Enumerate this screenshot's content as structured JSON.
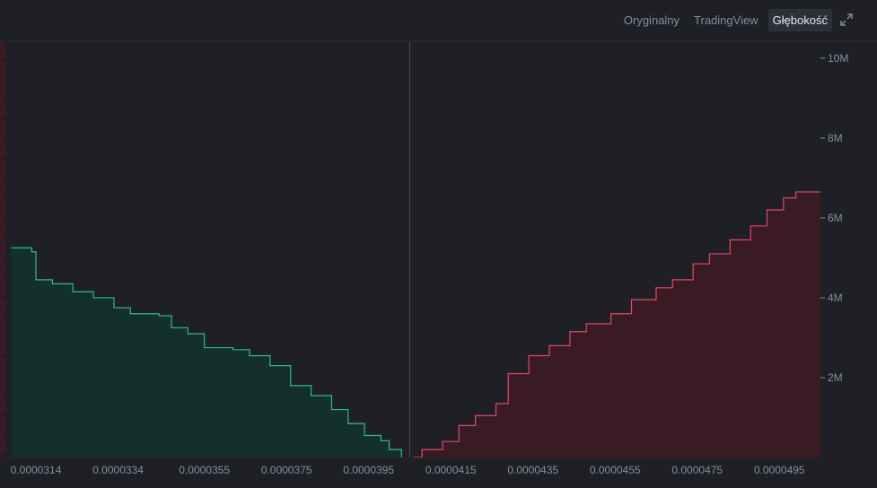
{
  "header": {
    "tabs": [
      {
        "label": "Oryginalny",
        "active": false
      },
      {
        "label": "TradingView",
        "active": false
      },
      {
        "label": "Głębokość",
        "active": true
      }
    ],
    "expand_icon": "expand-icon"
  },
  "colors": {
    "background": "#1e2026",
    "bid_line": "#2ebd85",
    "bid_fill": "#14302a",
    "ask_line": "#e0476b",
    "ask_fill": "#3a1b24",
    "axis_text": "#848e9c",
    "mid_line": "#474d57"
  },
  "chart_data": {
    "type": "area",
    "title": "",
    "xlabel": "",
    "ylabel": "",
    "x_ticks": [
      "0.0000314",
      "0.0000334",
      "0.0000355",
      "0.0000375",
      "0.0000395",
      "0.0000415",
      "0.0000435",
      "0.0000455",
      "0.0000475",
      "0.0000495"
    ],
    "y_ticks": [
      "2M",
      "4M",
      "6M",
      "8M",
      "10M"
    ],
    "x_range": [
      3.07e-05,
      5.05e-05
    ],
    "y_range": [
      0,
      10400000
    ],
    "mid_price": 4.05e-05,
    "series": [
      {
        "side": "bid",
        "points": [
          [
            3.08e-05,
            5.25
          ],
          [
            3.13e-05,
            5.15
          ],
          [
            3.14e-05,
            4.45
          ],
          [
            3.18e-05,
            4.35
          ],
          [
            3.23e-05,
            4.15
          ],
          [
            3.28e-05,
            4.0
          ],
          [
            3.33e-05,
            3.75
          ],
          [
            3.37e-05,
            3.6
          ],
          [
            3.44e-05,
            3.55
          ],
          [
            3.47e-05,
            3.25
          ],
          [
            3.51e-05,
            3.1
          ],
          [
            3.55e-05,
            2.75
          ],
          [
            3.62e-05,
            2.7
          ],
          [
            3.66e-05,
            2.55
          ],
          [
            3.71e-05,
            2.3
          ],
          [
            3.76e-05,
            1.8
          ],
          [
            3.81e-05,
            1.55
          ],
          [
            3.86e-05,
            1.2
          ],
          [
            3.9e-05,
            0.85
          ],
          [
            3.94e-05,
            0.55
          ],
          [
            3.98e-05,
            0.42
          ],
          [
            4e-05,
            0.2
          ],
          [
            4.03e-05,
            0.0
          ]
        ]
      },
      {
        "side": "ask",
        "points": [
          [
            4.06e-05,
            0.0
          ],
          [
            4.08e-05,
            0.2
          ],
          [
            4.13e-05,
            0.4
          ],
          [
            4.17e-05,
            0.8
          ],
          [
            4.21e-05,
            1.05
          ],
          [
            4.26e-05,
            1.35
          ],
          [
            4.29e-05,
            2.1
          ],
          [
            4.34e-05,
            2.55
          ],
          [
            4.39e-05,
            2.8
          ],
          [
            4.44e-05,
            3.15
          ],
          [
            4.48e-05,
            3.35
          ],
          [
            4.54e-05,
            3.6
          ],
          [
            4.59e-05,
            3.95
          ],
          [
            4.65e-05,
            4.25
          ],
          [
            4.69e-05,
            4.45
          ],
          [
            4.74e-05,
            4.85
          ],
          [
            4.78e-05,
            5.1
          ],
          [
            4.83e-05,
            5.45
          ],
          [
            4.88e-05,
            5.8
          ],
          [
            4.92e-05,
            6.2
          ],
          [
            4.96e-05,
            6.5
          ],
          [
            4.99e-05,
            6.65
          ]
        ]
      }
    ]
  }
}
